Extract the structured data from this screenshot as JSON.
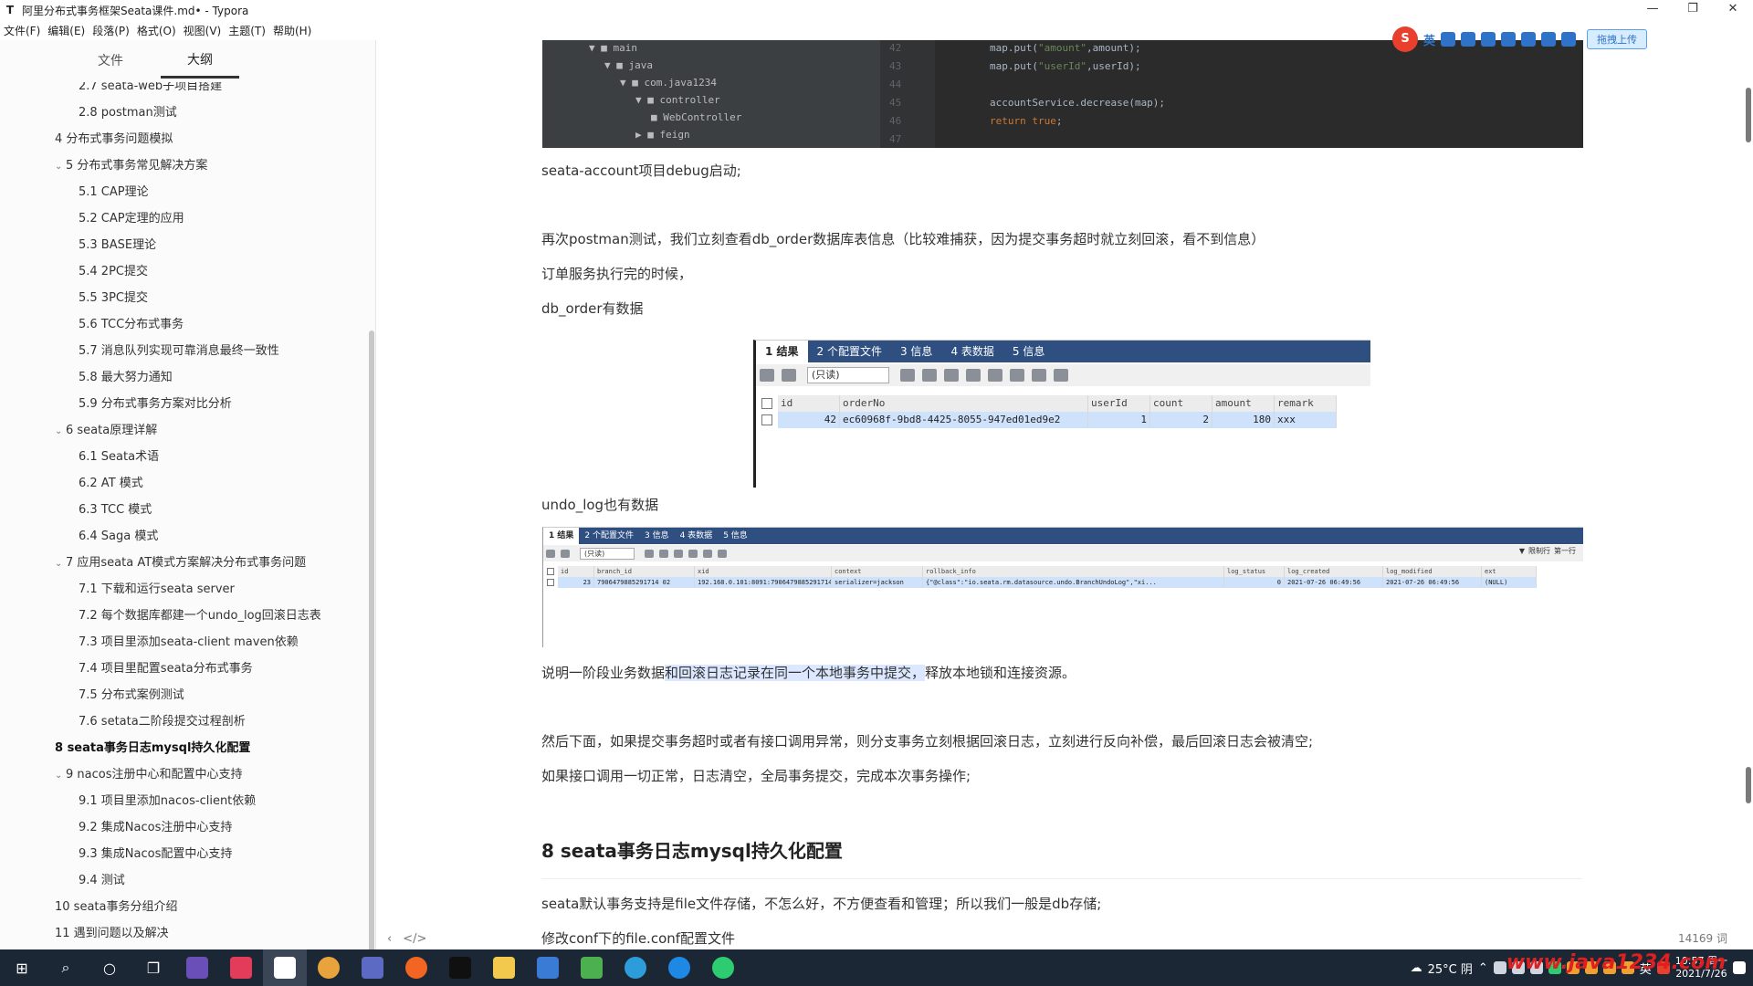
{
  "window": {
    "title": "阿里分布式事务框架Seata课件.md• - Typora",
    "app_icon": "T",
    "controls": [
      "—",
      "❐",
      "✕"
    ]
  },
  "menubar": [
    "文件(F)",
    "编辑(E)",
    "段落(P)",
    "格式(O)",
    "视图(V)",
    "主题(T)",
    "帮助(H)"
  ],
  "sidebar": {
    "tabs": [
      {
        "label": "文件",
        "active": false
      },
      {
        "label": "大纲",
        "active": true
      }
    ],
    "outline": [
      {
        "label": "2.7 seata-web子项目搭建",
        "level": 2
      },
      {
        "label": "2.8 postman测试",
        "level": 2
      },
      {
        "label": "4 分布式事务问题模拟",
        "level": 1
      },
      {
        "label": "5 分布式事务常见解决方案",
        "level": 1,
        "expanded": true
      },
      {
        "label": "5.1 CAP理论",
        "level": 2
      },
      {
        "label": "5.2 CAP定理的应用",
        "level": 2
      },
      {
        "label": "5.3 BASE理论",
        "level": 2
      },
      {
        "label": "5.4 2PC提交",
        "level": 2
      },
      {
        "label": "5.5 3PC提交",
        "level": 2
      },
      {
        "label": "5.6 TCC分布式事务",
        "level": 2
      },
      {
        "label": "5.7 消息队列实现可靠消息最终一致性",
        "level": 2
      },
      {
        "label": "5.8 最大努力通知",
        "level": 2
      },
      {
        "label": "5.9 分布式事务方案对比分析",
        "level": 2
      },
      {
        "label": "6 seata原理详解",
        "level": 1,
        "expanded": true
      },
      {
        "label": "6.1 Seata术语",
        "level": 2
      },
      {
        "label": "6.2 AT 模式",
        "level": 2
      },
      {
        "label": "6.3 TCC 模式",
        "level": 2
      },
      {
        "label": "6.4 Saga 模式",
        "level": 2
      },
      {
        "label": "7 应用seata AT模式方案解决分布式事务问题",
        "level": 1,
        "expanded": true
      },
      {
        "label": "7.1 下载和运行seata server",
        "level": 2
      },
      {
        "label": "7.2 每个数据库都建一个undo_log回滚日志表",
        "level": 2
      },
      {
        "label": "7.3 项目里添加seata-client maven依赖",
        "level": 2
      },
      {
        "label": "7.4 项目里配置seata分布式事务",
        "level": 2
      },
      {
        "label": "7.5 分布式案例测试",
        "level": 2
      },
      {
        "label": "7.6 setata二阶段提交过程剖析",
        "level": 2
      },
      {
        "label": "8 seata事务日志mysql持久化配置",
        "level": 1,
        "active": true
      },
      {
        "label": "9 nacos注册中心和配置中心支持",
        "level": 1,
        "expanded": true
      },
      {
        "label": "9.1 项目里添加nacos-client依赖",
        "level": 2
      },
      {
        "label": "9.2 集成Nacos注册中心支持",
        "level": 2
      },
      {
        "label": "9.3 集成Nacos配置中心支持",
        "level": 2
      },
      {
        "label": "9.4 测试",
        "level": 2
      },
      {
        "label": "10 seata事务分组介绍",
        "level": 1
      },
      {
        "label": "11 遇到问题以及解决",
        "level": 1
      }
    ],
    "footer": {
      "back": "‹",
      "source": "</>"
    }
  },
  "code_shot": {
    "tree": [
      {
        "label": "main",
        "indent": 3,
        "caret": "▼"
      },
      {
        "label": "java",
        "indent": 4,
        "caret": "▼"
      },
      {
        "label": "com.java1234",
        "indent": 5,
        "caret": "▼"
      },
      {
        "label": "controller",
        "indent": 6,
        "caret": "▼"
      },
      {
        "label": "WebController",
        "indent": 7,
        "caret": ""
      },
      {
        "label": "feign",
        "indent": 6,
        "caret": "▶"
      }
    ],
    "gutter": [
      "42",
      "43",
      "44",
      "45",
      "46",
      "47"
    ],
    "lines": [
      {
        "pre": "map.put(",
        "str": "\"amount\"",
        "post": ",amount);"
      },
      {
        "pre": "map.put(",
        "str": "\"userId\"",
        "post": ",userId);"
      },
      {
        "pre": "",
        "str": "",
        "post": ""
      },
      {
        "pre": "accountService.decrease(map);",
        "str": "",
        "post": ""
      },
      {
        "pre": "return true;",
        "str": "",
        "post": ""
      }
    ]
  },
  "content": {
    "p1": "seata-account项目debug启动;",
    "p2": "再次postman测试，我们立刻查看db_order数据库表信息（比较难捕获，因为提交事务超时就立刻回滚，看不到信息）",
    "p3": "订单服务执行完的时候，",
    "p4": "db_order有数据",
    "p5": "undo_log也有数据",
    "p6_pre": "说明一阶段业务数据",
    "p6_hl": "和回滚日志记录在同一个本地事务中提交，",
    "p6_post": "释放本地锁和连接资源。",
    "p7": "然后下面，如果提交事务超时或者有接口调用异常，则分支事务立刻根据回滚日志，立刻进行反向补偿，最后回滚日志会被清空;",
    "p8": "如果接口调用一切正常，日志清空，全局事务提交，完成本次事务操作;",
    "h2": "8 seata事务日志mysql持久化配置",
    "p9": "seata默认事务支持是file文件存储，不怎么好，不方便查看和管理；所以我们一般是db存储;",
    "p10": "修改conf下的file.conf配置文件",
    "word_count": "14169 词"
  },
  "db1": {
    "tabs": [
      "1 结果",
      "2 个配置文件",
      "3 信息",
      "4 表数据",
      "5 信息"
    ],
    "select": "(只读)",
    "columns": [
      "id",
      "orderNo",
      "userId",
      "count",
      "amount",
      "remark"
    ],
    "row": [
      "42",
      "ec60968f-9bd8-4425-8055-947ed01ed9e2",
      "1",
      "2",
      "180",
      "xxx"
    ]
  },
  "db2": {
    "tabs": [
      "1 结果",
      "2 个配置文件",
      "3 信息",
      "4 表数据",
      "5 信息"
    ],
    "select": "(只读)",
    "filter": [
      "限制行",
      "第一行"
    ],
    "columns": [
      "id",
      "branch_id",
      "xid",
      "context",
      "rollback_info",
      "log_status",
      "log_created",
      "log_modified",
      "ext"
    ],
    "row": [
      "23",
      "7906479885291714 02",
      "192.168.0.101:8091:7906479885291714 01",
      "serializer=jackson",
      "{\"@class\":\"io.seata.rm.datasource.undo.BranchUndoLog\",\"xi...",
      "0",
      "2021-07-26 06:49:56",
      "2021-07-26 06:49:56",
      "(NULL)"
    ]
  },
  "ime": {
    "logo": "S",
    "lang": "英",
    "upload": "拖拽上传"
  },
  "taskbar": {
    "weather": "25°C 阴",
    "lang": "英",
    "time": "10:57 周一",
    "date": "2021/7/26",
    "watermark": "www.java1234.com"
  },
  "colors": {
    "taskbar_bg": "#1c2736",
    "accent": "#2e4f80",
    "highlight": "#dbe8ff"
  }
}
